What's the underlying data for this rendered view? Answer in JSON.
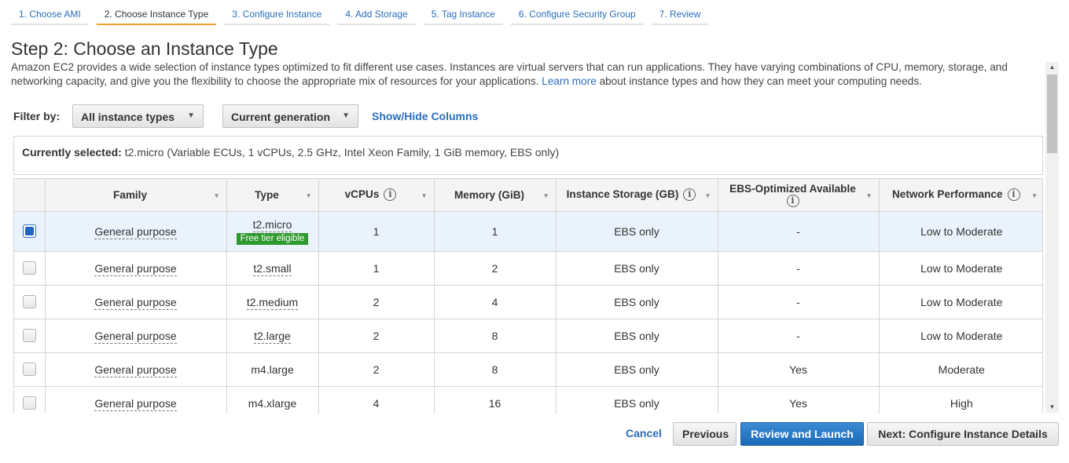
{
  "wizard": {
    "tabs": [
      {
        "label": "1. Choose AMI"
      },
      {
        "label": "2. Choose Instance Type"
      },
      {
        "label": "3. Configure Instance"
      },
      {
        "label": "4. Add Storage"
      },
      {
        "label": "5. Tag Instance"
      },
      {
        "label": "6. Configure Security Group"
      },
      {
        "label": "7. Review"
      }
    ]
  },
  "page": {
    "title": "Step 2: Choose an Instance Type",
    "desc_before": "Amazon EC2 provides a wide selection of instance types optimized to fit different use cases. Instances are virtual servers that can run applications. They have varying combinations of CPU, memory, storage, and networking capacity, and give you the flexibility to choose the appropriate mix of resources for your applications.",
    "desc_link": "Learn more",
    "desc_after": "about instance types and how they can meet your computing needs."
  },
  "filter": {
    "label": "Filter by:",
    "type_select": "All instance types",
    "generation_select": "Current generation",
    "show_hide": "Show/Hide Columns"
  },
  "current": {
    "label": "Currently selected:",
    "value": "t2.micro (Variable ECUs, 1 vCPUs, 2.5 GHz, Intel Xeon Family, 1 GiB memory, EBS only)"
  },
  "table": {
    "headers": {
      "family": "Family",
      "type": "Type",
      "vcpus": "vCPUs",
      "memory": "Memory (GiB)",
      "storage": "Instance Storage (GB)",
      "ebs": "EBS-Optimized Available",
      "network": "Network Performance"
    },
    "rows": [
      {
        "family": "General purpose",
        "type": "t2.micro",
        "badge": "Free tier eligible",
        "vcpus": "1",
        "memory": "1",
        "storage": "EBS only",
        "ebs": "-",
        "network": "Low to Moderate",
        "selected": true
      },
      {
        "family": "General purpose",
        "type": "t2.small",
        "vcpus": "1",
        "memory": "2",
        "storage": "EBS only",
        "ebs": "-",
        "network": "Low to Moderate"
      },
      {
        "family": "General purpose",
        "type": "t2.medium",
        "vcpus": "2",
        "memory": "4",
        "storage": "EBS only",
        "ebs": "-",
        "network": "Low to Moderate"
      },
      {
        "family": "General purpose",
        "type": "t2.large",
        "vcpus": "2",
        "memory": "8",
        "storage": "EBS only",
        "ebs": "-",
        "network": "Low to Moderate"
      },
      {
        "family": "General purpose",
        "type": "m4.large",
        "vcpus": "2",
        "memory": "8",
        "storage": "EBS only",
        "ebs": "Yes",
        "network": "Moderate"
      },
      {
        "family": "General purpose",
        "type": "m4.xlarge",
        "vcpus": "4",
        "memory": "16",
        "storage": "EBS only",
        "ebs": "Yes",
        "network": "High"
      }
    ]
  },
  "buttons": {
    "cancel": "Cancel",
    "previous": "Previous",
    "review": "Review and Launch",
    "next": "Next: Configure Instance Details"
  },
  "colors": {
    "link": "#2a6ebb",
    "primary": "#1e6bb8",
    "active_tab": "#f0a030",
    "free_tier": "#2e9a2e",
    "selected_row": "#eaf3fb"
  }
}
